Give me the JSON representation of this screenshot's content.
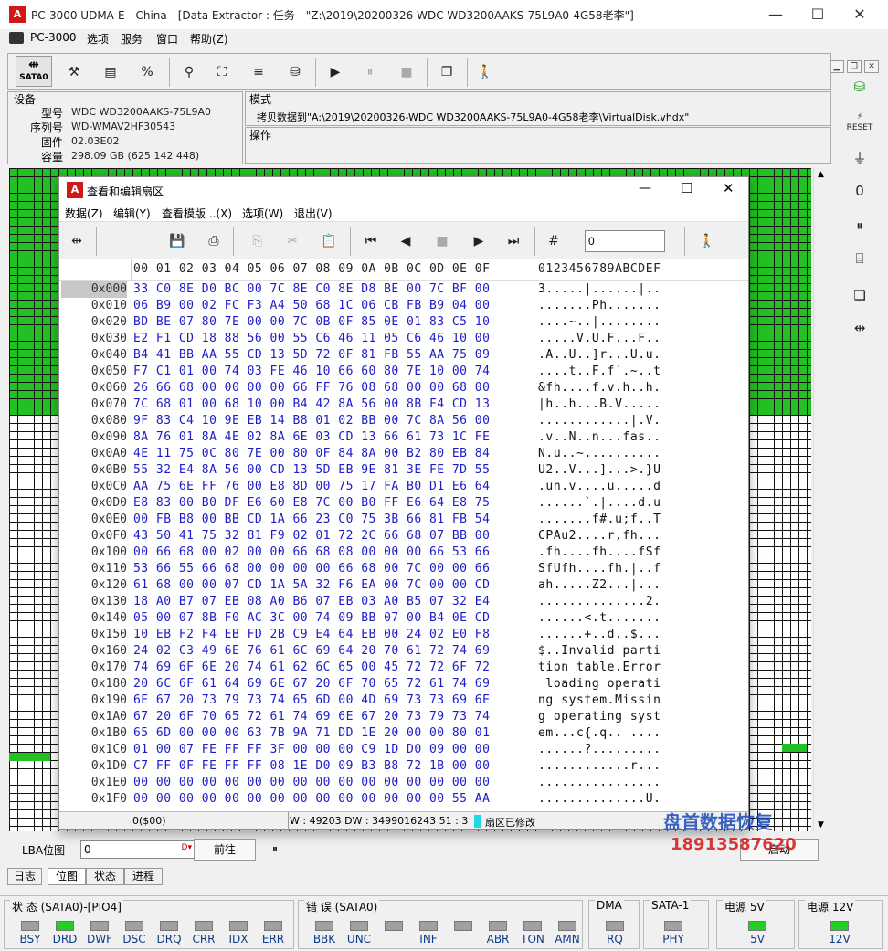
{
  "window": {
    "title": "PC-3000 UDMA-E - China - [Data Extractor : 任务 - \"Z:\\2019\\20200326-WDC WD3200AAKS-75L9A0-4G58老李\"]",
    "minimize": "—",
    "maximize": "☐",
    "close": "✕"
  },
  "menu": {
    "pc3000": "PC-3000",
    "options": "选项",
    "service": "服务",
    "window": "窗口",
    "help": "帮助(Z)"
  },
  "toolbar": {
    "sata_label": "SATA0"
  },
  "device": {
    "section_title": "设备",
    "model_label": "型号",
    "model_value": "WDC WD3200AAKS-75L9A0",
    "serial_label": "序列号",
    "serial_value": "WD-WMAV2HF30543",
    "firmware_label": "固件",
    "firmware_value": "02.03E02",
    "capacity_label": "容量",
    "capacity_value": "298.09 GB (625 142 448)"
  },
  "mode": {
    "section_title": "模式",
    "text": "拷贝数据到\"A:\\2019\\20200326-WDC WD3200AAKS-75L9A0-4G58老李\\VirtualDisk.vhdx\""
  },
  "operation": {
    "section_title": "操作"
  },
  "sector_map": {
    "good_fraction": 0.37
  },
  "hexwin": {
    "title": "查看和编辑扇区",
    "menu": [
      "数据(Z)",
      "编辑(Y)",
      "查看模版 ..(X)",
      "选项(W)",
      "退出(V)"
    ],
    "offset_input": "0",
    "header_offsets": "00 01 02 03 04 05 06 07 08 09 0A 0B 0C 0D 0E 0F",
    "header_ascii": "0123456789ABCDEF",
    "rows": [
      {
        "addr": "0x000",
        "hex": "33 C0 8E D0 BC 00 7C 8E C0 8E D8 BE 00 7C BF 00",
        "ascii": "3.....|......|.."
      },
      {
        "addr": "0x010",
        "hex": "06 B9 00 02 FC F3 A4 50 68 1C 06 CB FB B9 04 00",
        "ascii": ".......Ph......."
      },
      {
        "addr": "0x020",
        "hex": "BD BE 07 80 7E 00 00 7C 0B 0F 85 0E 01 83 C5 10",
        "ascii": "....~..|........"
      },
      {
        "addr": "0x030",
        "hex": "E2 F1 CD 18 88 56 00 55 C6 46 11 05 C6 46 10 00",
        "ascii": ".....V.U.F...F.."
      },
      {
        "addr": "0x040",
        "hex": "B4 41 BB AA 55 CD 13 5D 72 0F 81 FB 55 AA 75 09",
        "ascii": ".A..U..]r...U.u."
      },
      {
        "addr": "0x050",
        "hex": "F7 C1 01 00 74 03 FE 46 10 66 60 80 7E 10 00 74",
        "ascii": "....t..F.f`.~..t"
      },
      {
        "addr": "0x060",
        "hex": "26 66 68 00 00 00 00 66 FF 76 08 68 00 00 68 00",
        "ascii": "&fh....f.v.h..h."
      },
      {
        "addr": "0x070",
        "hex": "7C 68 01 00 68 10 00 B4 42 8A 56 00 8B F4 CD 13",
        "ascii": "|h..h...B.V....."
      },
      {
        "addr": "0x080",
        "hex": "9F 83 C4 10 9E EB 14 B8 01 02 BB 00 7C 8A 56 00",
        "ascii": "............|.V."
      },
      {
        "addr": "0x090",
        "hex": "8A 76 01 8A 4E 02 8A 6E 03 CD 13 66 61 73 1C FE",
        "ascii": ".v..N..n...fas.."
      },
      {
        "addr": "0x0A0",
        "hex": "4E 11 75 0C 80 7E 00 80 0F 84 8A 00 B2 80 EB 84",
        "ascii": "N.u..~.........."
      },
      {
        "addr": "0x0B0",
        "hex": "55 32 E4 8A 56 00 CD 13 5D EB 9E 81 3E FE 7D 55",
        "ascii": "U2..V...]...>.}U"
      },
      {
        "addr": "0x0C0",
        "hex": "AA 75 6E FF 76 00 E8 8D 00 75 17 FA B0 D1 E6 64",
        "ascii": ".un.v....u.....d"
      },
      {
        "addr": "0x0D0",
        "hex": "E8 83 00 B0 DF E6 60 E8 7C 00 B0 FF E6 64 E8 75",
        "ascii": "......`.|....d.u"
      },
      {
        "addr": "0x0E0",
        "hex": "00 FB B8 00 BB CD 1A 66 23 C0 75 3B 66 81 FB 54",
        "ascii": ".......f#.u;f..T"
      },
      {
        "addr": "0x0F0",
        "hex": "43 50 41 75 32 81 F9 02 01 72 2C 66 68 07 BB 00",
        "ascii": "CPAu2....r,fh..."
      },
      {
        "addr": "0x100",
        "hex": "00 66 68 00 02 00 00 66 68 08 00 00 00 66 53 66",
        "ascii": ".fh....fh....fSf"
      },
      {
        "addr": "0x110",
        "hex": "53 66 55 66 68 00 00 00 00 66 68 00 7C 00 00 66",
        "ascii": "SfUfh....fh.|..f"
      },
      {
        "addr": "0x120",
        "hex": "61 68 00 00 07 CD 1A 5A 32 F6 EA 00 7C 00 00 CD",
        "ascii": "ah.....Z2...|..."
      },
      {
        "addr": "0x130",
        "hex": "18 A0 B7 07 EB 08 A0 B6 07 EB 03 A0 B5 07 32 E4",
        "ascii": "..............2."
      },
      {
        "addr": "0x140",
        "hex": "05 00 07 8B F0 AC 3C 00 74 09 BB 07 00 B4 0E CD",
        "ascii": "......<.t......."
      },
      {
        "addr": "0x150",
        "hex": "10 EB F2 F4 EB FD 2B C9 E4 64 EB 00 24 02 E0 F8",
        "ascii": "......+..d..$..."
      },
      {
        "addr": "0x160",
        "hex": "24 02 C3 49 6E 76 61 6C 69 64 20 70 61 72 74 69",
        "ascii": "$..Invalid parti"
      },
      {
        "addr": "0x170",
        "hex": "74 69 6F 6E 20 74 61 62 6C 65 00 45 72 72 6F 72",
        "ascii": "tion table.Error"
      },
      {
        "addr": "0x180",
        "hex": "20 6C 6F 61 64 69 6E 67 20 6F 70 65 72 61 74 69",
        "ascii": " loading operati"
      },
      {
        "addr": "0x190",
        "hex": "6E 67 20 73 79 73 74 65 6D 00 4D 69 73 73 69 6E",
        "ascii": "ng system.Missin"
      },
      {
        "addr": "0x1A0",
        "hex": "67 20 6F 70 65 72 61 74 69 6E 67 20 73 79 73 74",
        "ascii": "g operating syst"
      },
      {
        "addr": "0x1B0",
        "hex": "65 6D 00 00 00 63 7B 9A 71 DD 1E 20 00 00 80 01",
        "ascii": "em...c{.q.. ...."
      },
      {
        "addr": "0x1C0",
        "hex": "01 00 07 FE FF FF 3F 00 00 00 C9 1D D0 09 00 00",
        "ascii": "......?........."
      },
      {
        "addr": "0x1D0",
        "hex": "C7 FF 0F FE FF FF 08 1E D0 09 B3 B8 72 1B 00 00",
        "ascii": "............r..."
      },
      {
        "addr": "0x1E0",
        "hex": "00 00 00 00 00 00 00 00 00 00 00 00 00 00 00 00",
        "ascii": "................"
      },
      {
        "addr": "0x1F0",
        "hex": "00 00 00 00 00 00 00 00 00 00 00 00 00 00 55 AA",
        "ascii": "..............U."
      }
    ],
    "status_offset": "0($00)",
    "status_info": "3 : 51 W : 49203 DW : 3499016243",
    "status_modified": "扇区已修改"
  },
  "lba": {
    "label": "LBA位图",
    "value": "0",
    "goto": "前往",
    "pause": "⏸",
    "right_button": "启动"
  },
  "tabs": [
    "日志",
    "位图",
    "状态",
    "进程"
  ],
  "status": {
    "group1_title": "状 态 (SATA0)-[PIO4]",
    "group1": [
      {
        "label": "BSY",
        "on": false
      },
      {
        "label": "DRD",
        "on": true
      },
      {
        "label": "DWF",
        "on": false
      },
      {
        "label": "DSC",
        "on": false
      },
      {
        "label": "DRQ",
        "on": false
      },
      {
        "label": "CRR",
        "on": false
      },
      {
        "label": "IDX",
        "on": false
      },
      {
        "label": "ERR",
        "on": false
      }
    ],
    "group2_title": "错 误 (SATA0)",
    "group2": [
      {
        "label": "BBK",
        "on": false
      },
      {
        "label": "UNC",
        "on": false
      },
      {
        "label": "",
        "on": false
      },
      {
        "label": "INF",
        "on": false
      },
      {
        "label": "",
        "on": false
      },
      {
        "label": "ABR",
        "on": false
      },
      {
        "label": "TON",
        "on": false
      },
      {
        "label": "AMN",
        "on": false
      }
    ],
    "dma_title": "DMA",
    "dma_label": "RQ",
    "sata_title": "SATA-1",
    "sata_label": "PHY",
    "p5_title": "电源 5V",
    "p5_label": "5V",
    "p12_title": "电源 12V",
    "p12_label": "12V"
  },
  "watermark": {
    "line1": "盘首数据恢复",
    "line2": "18913587620"
  }
}
